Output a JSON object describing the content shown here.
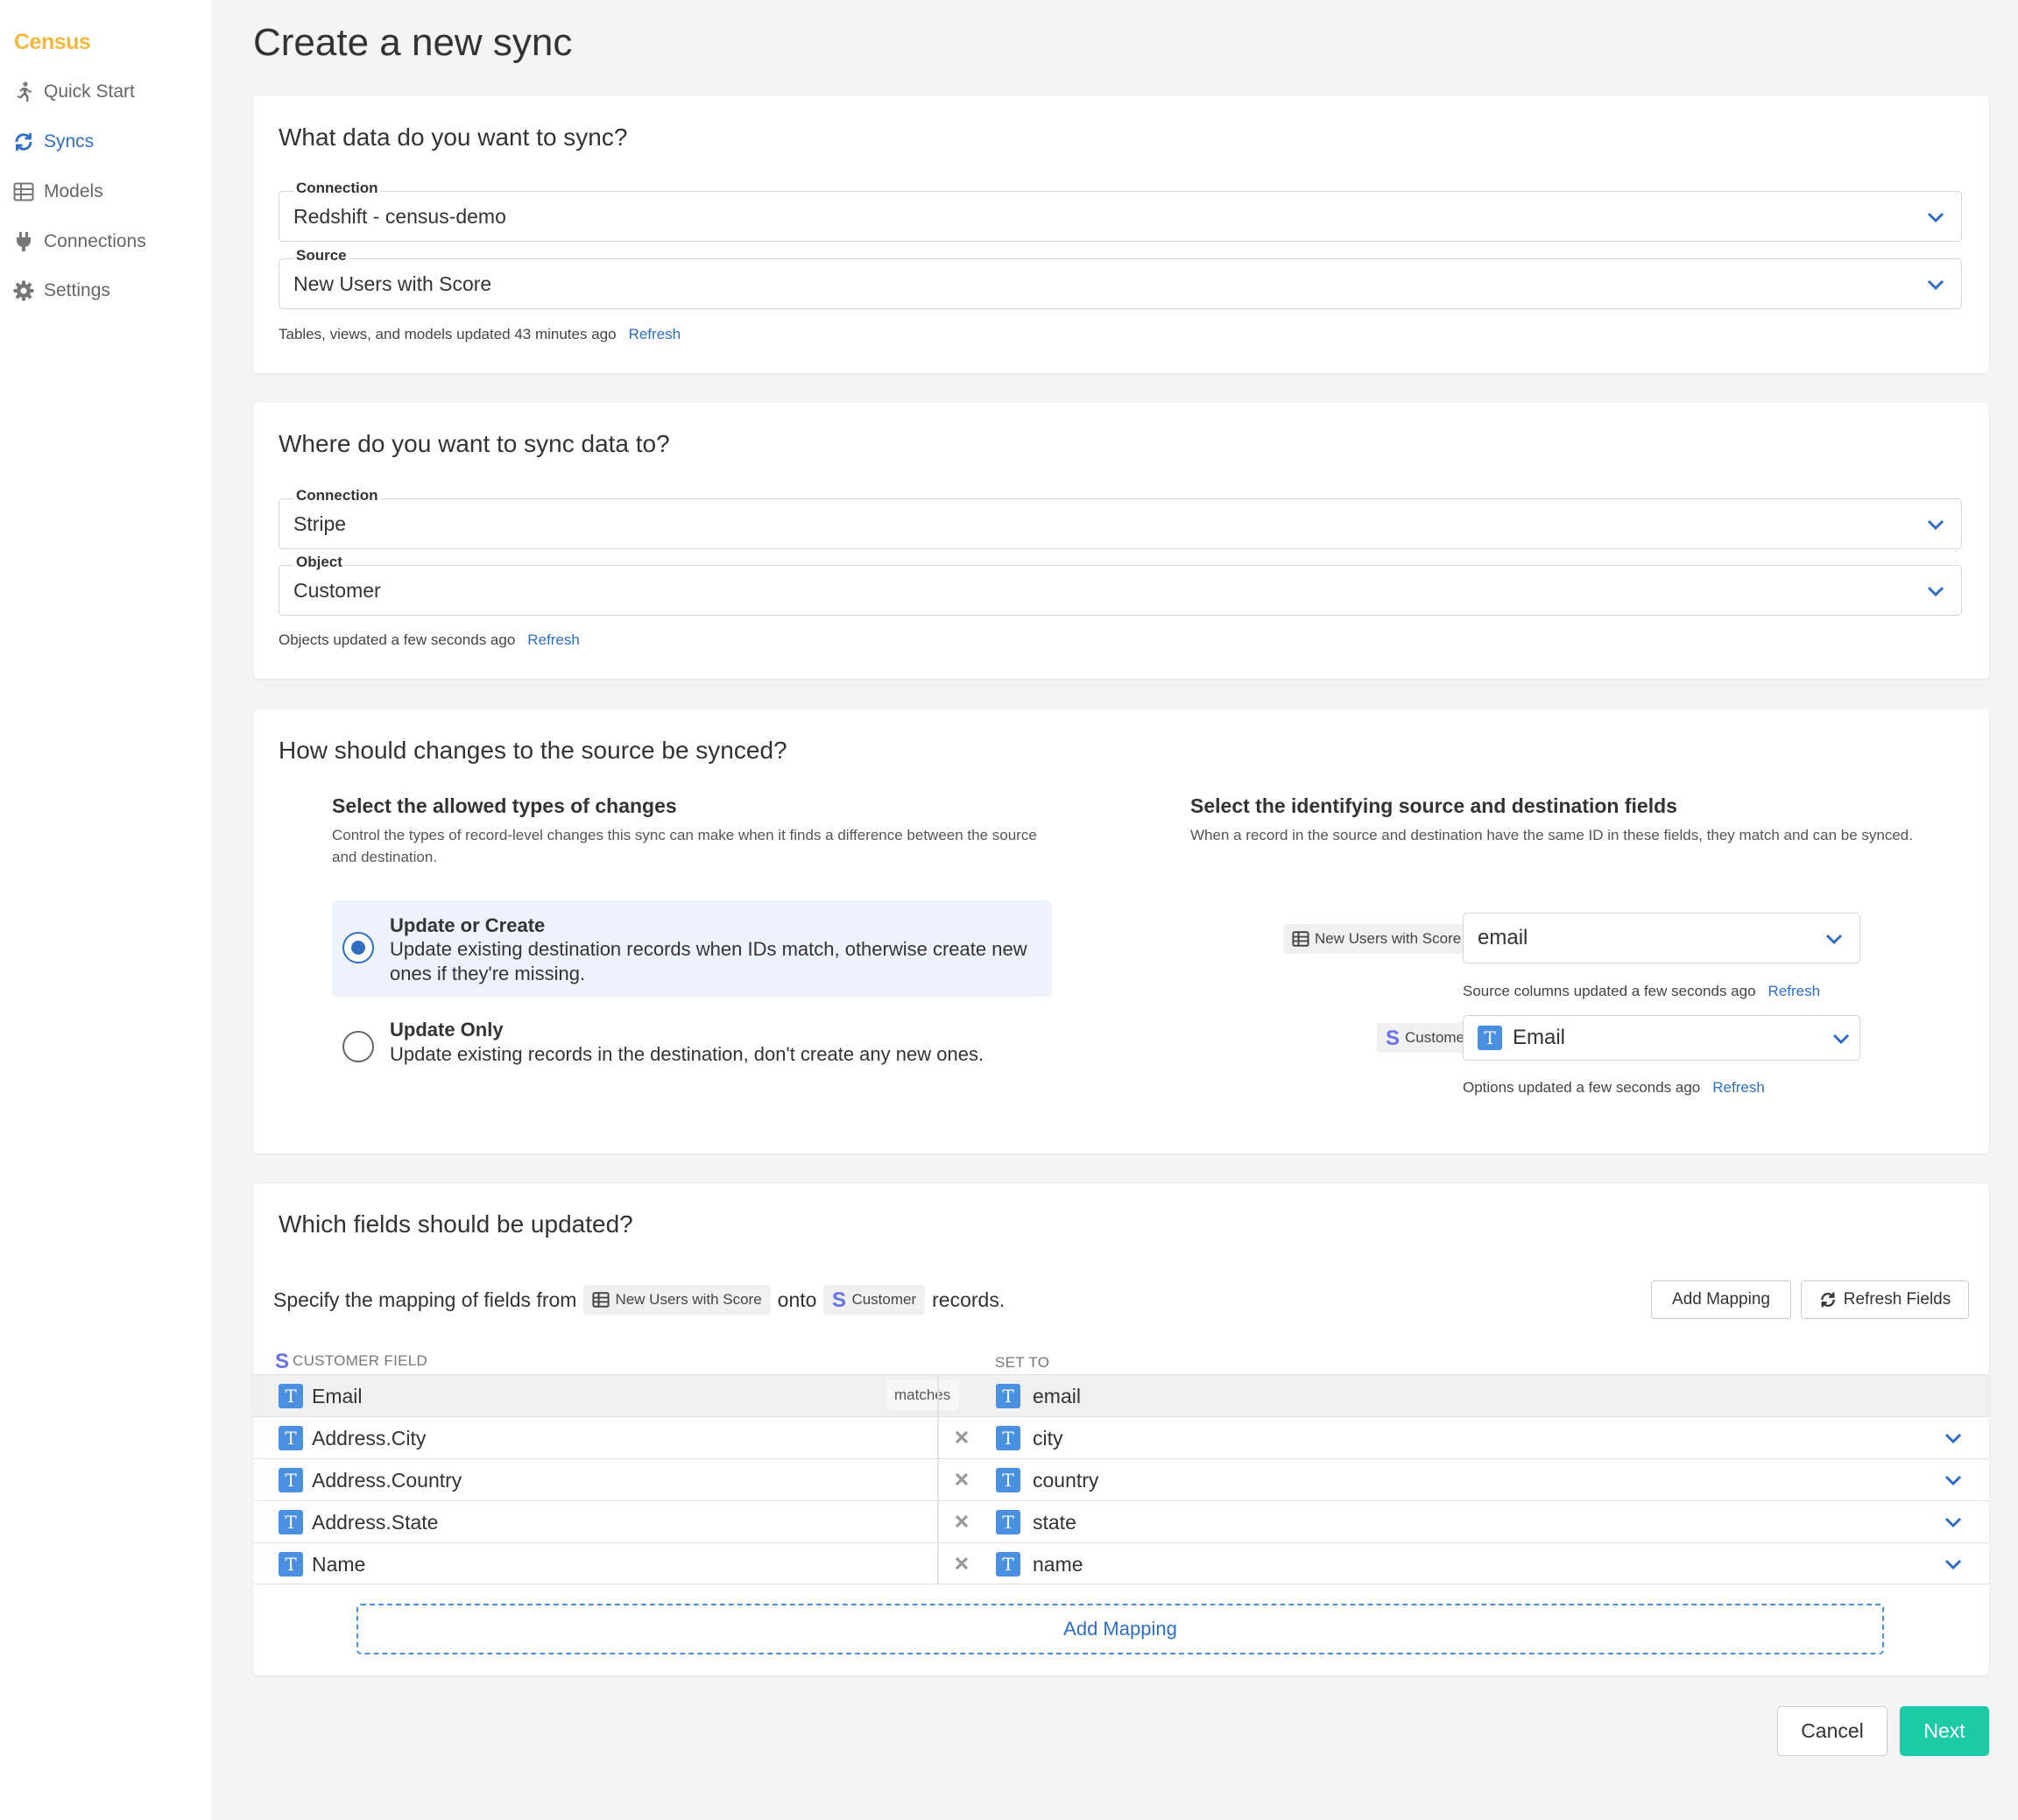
{
  "brand": "Census",
  "nav": {
    "items": [
      {
        "label": "Quick Start",
        "icon": "runner-icon"
      },
      {
        "label": "Syncs",
        "icon": "sync-icon"
      },
      {
        "label": "Models",
        "icon": "table-icon"
      },
      {
        "label": "Connections",
        "icon": "plug-icon"
      },
      {
        "label": "Settings",
        "icon": "gear-icon"
      }
    ],
    "active": "Syncs"
  },
  "page_title": "Create a new sync",
  "source_card": {
    "title": "What data do you want to sync?",
    "connection_label": "Connection",
    "connection_value": "Redshift - census-demo",
    "source_label": "Source",
    "source_value": "New Users with Score",
    "hint": "Tables, views, and models updated 43 minutes ago",
    "refresh": "Refresh"
  },
  "dest_card": {
    "title": "Where do you want to sync data to?",
    "connection_label": "Connection",
    "connection_value": "Stripe",
    "object_label": "Object",
    "object_value": "Customer",
    "hint": "Objects updated a few seconds ago",
    "refresh": "Refresh"
  },
  "changes_card": {
    "title": "How should changes to the source be synced?",
    "left_heading": "Select the allowed types of changes",
    "left_desc": "Control the types of record-level changes this sync can make when it finds a difference between the source and destination.",
    "options": [
      {
        "title": "Update or Create",
        "desc": "Update existing destination records when IDs match, otherwise create new ones if they're missing.",
        "selected": true
      },
      {
        "title": "Update Only",
        "desc": "Update existing records in the destination, don't create any new ones.",
        "selected": false
      }
    ],
    "right_heading": "Select the identifying source and destination fields",
    "right_desc": "When a record in the source and destination have the same ID in these fields, they match and can be synced.",
    "source_pill": "New Users with Score",
    "source_field": "email",
    "source_hint": "Source columns updated a few seconds ago",
    "dest_pill": "Customer",
    "dest_field": "Email",
    "dest_hint": "Options updated a few seconds ago",
    "refresh": "Refresh"
  },
  "fields_card": {
    "title": "Which fields should be updated?",
    "spec_prefix": "Specify the mapping of fields from",
    "spec_source": "New Users with Score",
    "spec_onto": "onto",
    "spec_dest": "Customer",
    "spec_suffix": "records.",
    "add_mapping_btn": "Add Mapping",
    "refresh_fields_btn": "Refresh Fields",
    "col_left": "CUSTOMER FIELD",
    "col_right": "SET TO",
    "matches_label": "matches",
    "rows": [
      {
        "field": "Email",
        "set_to": "email"
      },
      {
        "field": "Address.City",
        "set_to": "city"
      },
      {
        "field": "Address.Country",
        "set_to": "country"
      },
      {
        "field": "Address.State",
        "set_to": "state"
      },
      {
        "field": "Name",
        "set_to": "name"
      }
    ],
    "add_mapping_link": "Add Mapping",
    "type_badge": "T"
  },
  "footer": {
    "cancel": "Cancel",
    "next": "Next"
  },
  "colors": {
    "accent": "#2f6ec2",
    "brand": "#f3b83f",
    "next_button": "#1ccaa8",
    "stripe": "#6772e5"
  }
}
